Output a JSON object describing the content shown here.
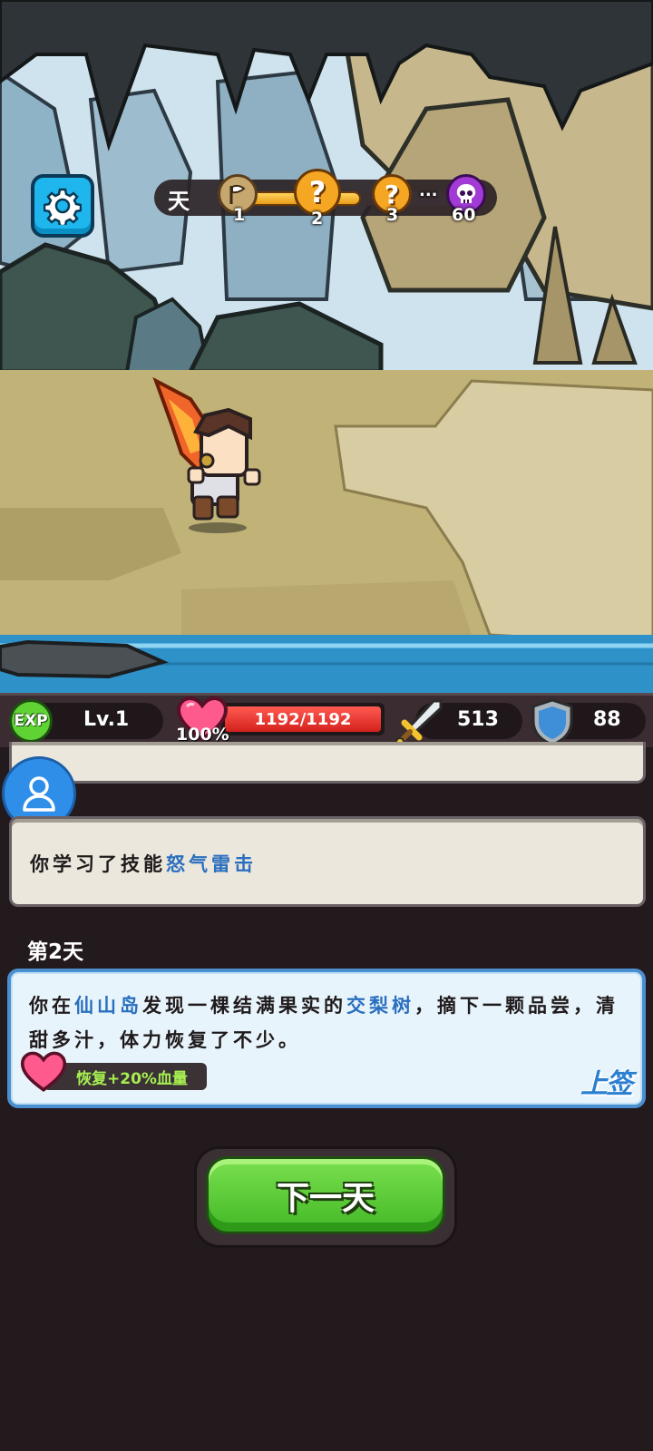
{
  "journey": {
    "day_char": "天",
    "progress_fraction": 0.55,
    "nodes": [
      {
        "icon": "flag-icon",
        "label": "1"
      },
      {
        "icon": "question-icon",
        "label": "2"
      },
      {
        "icon": "question-icon",
        "label": "3"
      },
      {
        "icon": "skull-icon",
        "label": "60"
      }
    ],
    "ellipsis": "..."
  },
  "stats": {
    "exp_badge": "EXP",
    "level": "Lv.1",
    "hp_percent": "100%",
    "hp_text": "1192/1192",
    "hp_fraction": 1.0,
    "attack": "513",
    "defense": "88"
  },
  "log": {
    "skill_prefix": "你学习了技能",
    "skill_name": "怒气雷击",
    "day_title": "第2天",
    "event": {
      "t1": "你在",
      "place": "仙山岛",
      "t2": "发现一棵结满果实的",
      "tree": "交梨树",
      "t3": "，摘下一颗品尝，清甜多汁，体力恢复了不少。",
      "reward": "恢复+20%血量",
      "signature": "上签"
    }
  },
  "buttons": {
    "next_day": "下一天"
  },
  "colors": {
    "highlight": "#2a6fbf",
    "reward_text": "#a6ee52",
    "button_green": "#55c832"
  }
}
